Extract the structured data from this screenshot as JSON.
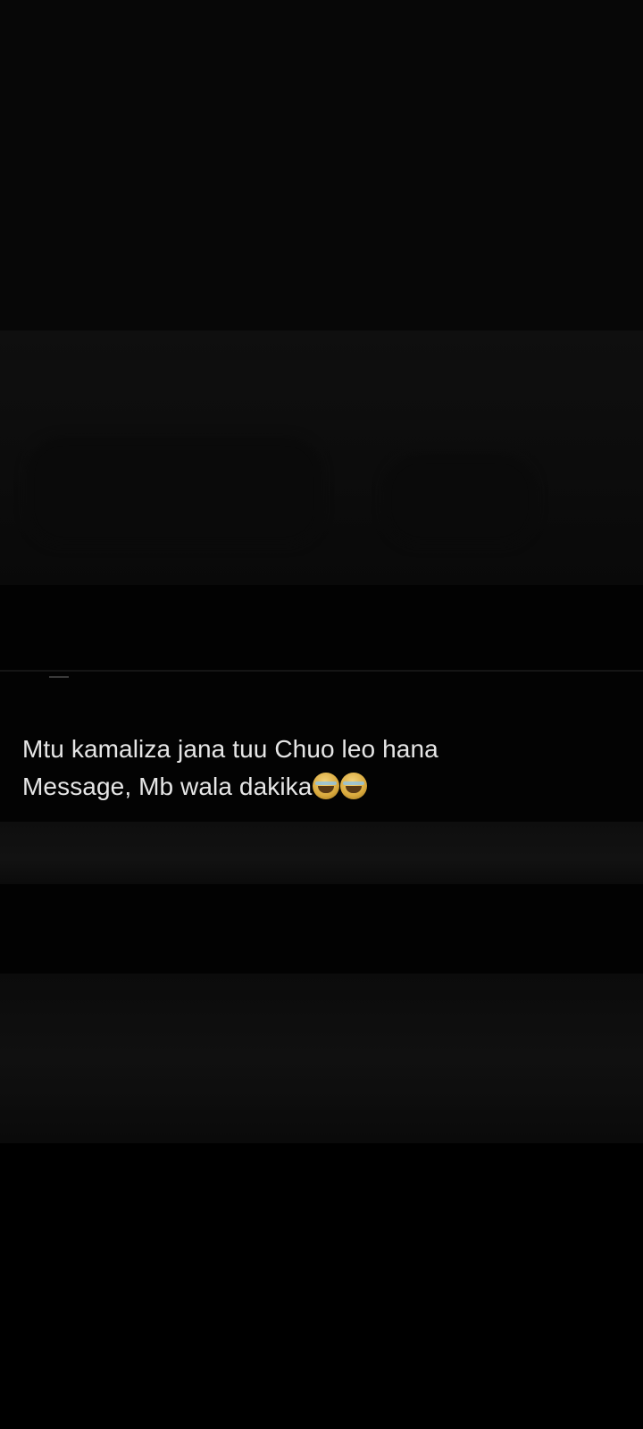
{
  "tweet": {
    "line1": "Mtu kamaliza jana tuu Chuo leo hana",
    "line2": "Message, Mb wala dakika",
    "emojis": [
      "face-with-tears-of-joy-icon",
      "face-with-tears-of-joy-icon"
    ]
  },
  "colors": {
    "background": "#000000",
    "text": "#e6e6e6"
  }
}
